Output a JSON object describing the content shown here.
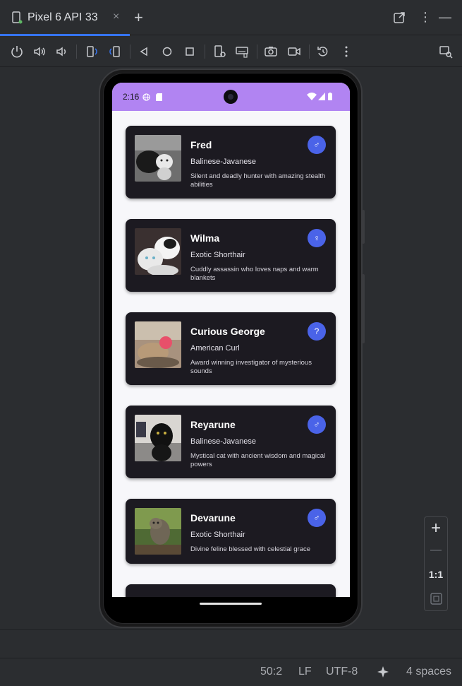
{
  "tab": {
    "title": "Pixel 6 API 33",
    "close": "×",
    "add": "+"
  },
  "window_actions": {
    "open_external": "⧉",
    "more": "⋮",
    "minimize": "—"
  },
  "toolbar_icons": [
    "power-icon",
    "volume-up-icon",
    "volume-down-icon",
    "rotate-left-icon",
    "rotate-right-icon",
    "back-icon",
    "home-icon",
    "overview-icon",
    "settings-icon",
    "keyboard-icon",
    "camera-icon",
    "video-icon",
    "snapshot-icon",
    "more-icon",
    "inspect-icon"
  ],
  "phone": {
    "status": {
      "time": "2:16"
    },
    "cats": [
      {
        "name": "Fred",
        "breed": "Balinese-Javanese",
        "description": "Silent and deadly hunter with amazing stealth abilities",
        "gender": "♂"
      },
      {
        "name": "Wilma",
        "breed": "Exotic Shorthair",
        "description": "Cuddly assassin who loves naps and warm blankets",
        "gender": "♀"
      },
      {
        "name": "Curious George",
        "breed": "American Curl",
        "description": "Award winning investigator of mysterious sounds",
        "gender": "?"
      },
      {
        "name": "Reyarune",
        "breed": "Balinese-Javanese",
        "description": "Mystical cat with ancient wisdom and magical powers",
        "gender": "♂"
      },
      {
        "name": "Devarune",
        "breed": "Exotic Shorthair",
        "description": "Divine feline blessed with celestial grace",
        "gender": "♂"
      }
    ]
  },
  "zoom": {
    "in": "+",
    "out": "—",
    "actual": "1:1"
  },
  "status_bar": {
    "position": "50:2",
    "line_ending": "LF",
    "encoding": "UTF-8",
    "indent": "4 spaces"
  },
  "colors": {
    "accent": "#3574f0",
    "status_bar": "#b184f2",
    "card": "#1c1a21",
    "gender_badge": "#4a63e8"
  }
}
